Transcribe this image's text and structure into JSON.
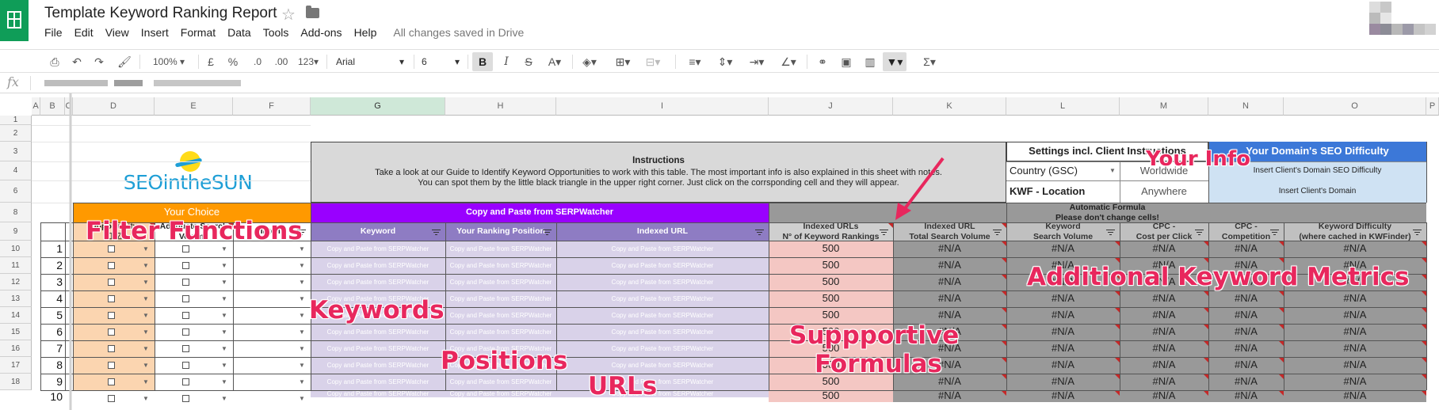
{
  "doc": {
    "title": "Template Keyword Ranking Report",
    "save_status": "All changes saved in Drive"
  },
  "menu": [
    "File",
    "Edit",
    "View",
    "Insert",
    "Format",
    "Data",
    "Tools",
    "Add-ons",
    "Help"
  ],
  "toolbar": {
    "zoom": "100%",
    "currency": "£",
    "percent": "%",
    "dec_less": ".0",
    "dec_more": ".00",
    "format_more": "123",
    "font": "Arial",
    "font_size": "6",
    "bold": "B",
    "italic": "I",
    "strike": "S",
    "text_color": "A",
    "sum": "Σ"
  },
  "formula": {
    "fx": "fx"
  },
  "columns": [
    "A",
    "B",
    "C",
    "D",
    "E",
    "F",
    "G",
    "H",
    "I",
    "J",
    "K",
    "L",
    "M",
    "N",
    "O",
    "P"
  ],
  "selected_column": "G",
  "row_numbers": [
    "1",
    "2",
    "3",
    "4",
    "6",
    "8",
    "9",
    "10",
    "11",
    "12",
    "13",
    "14",
    "15",
    "16",
    "17",
    "18"
  ],
  "logo": {
    "text": "SEOintheSUN"
  },
  "instructions": {
    "title": "Instructions",
    "line1": "Take a look at our Guide to Identify Keyword Opportunities to work with this table. The most important info is also explained in this sheet with notes.",
    "line2": "You can spot them by the little black triangle in the upper right corner. Just click on the corrsponding cell and they will appear."
  },
  "settings": {
    "title": "Settings incl. Client Instructions",
    "country_label": "Country (GSC)",
    "country_value": "Worldwide",
    "location_label": "KWF - Location",
    "location_value": "Anywhere"
  },
  "seo_difficulty": {
    "title": "Your Domain's SEO Difficulty",
    "line1": "Insert Client's Domain SEO Difficulty",
    "line2": "Insert Client's Domain"
  },
  "groups": {
    "your_choice": "Your Choice",
    "copy_paste": "Copy and Paste from SERPWatcher",
    "auto_line1": "Automatic Formula",
    "auto_line2": "Please don't change cells!"
  },
  "headers": {
    "opportunity": "Opportunity",
    "checkbox_marks": "☐,☑",
    "adequate_line1": "Adequate Search",
    "adequate_line2": "Volume",
    "intent": "Intent",
    "keyword": "Keyword",
    "ranking_position": "Your Ranking Position",
    "indexed_url": "Indexed URL",
    "indexed_urls_line1": "Indexed URLs",
    "indexed_urls_line2": "N° of Keyword Rankings",
    "total_volume_line1": "Indexed URL",
    "total_volume_line2": "Total Search Volume",
    "kw_volume_line1": "Keyword",
    "kw_volume_line2": "Search Volume",
    "cpc_line1": "CPC -",
    "cpc_line2": "Cost per Click",
    "cpc_comp_line1": "CPC -",
    "cpc_comp_line2": "Competition",
    "difficulty_line1": "Keyword Difficulty",
    "difficulty_line2": "(where cached in KWFinder)"
  },
  "row_index": [
    "1",
    "2",
    "3",
    "4",
    "5",
    "6",
    "7",
    "8",
    "9",
    "10"
  ],
  "placeholder": "Copy and Paste from SERPWatcher",
  "indexed_value": "500",
  "na": "#N/A",
  "annotations": {
    "filter": "Filter Functions",
    "keywords": "Keywords",
    "positions": "Positions",
    "urls": "URLs",
    "supportive_1": "Suppportive",
    "supportive_2": "Formulas",
    "metrics": "Additional Keyword Metrics",
    "your_info": "Your Info"
  },
  "colors": {
    "sheets_green": "#0f9d58",
    "orange": "#ff9900",
    "orange_light": "#fbd5b0",
    "purple": "#9900ff",
    "lavender": "#8e7cc3",
    "lavender_light": "#d9d2e9",
    "salmon": "#f4c7c3",
    "gray_dark": "#999999",
    "gray_header": "#c0c0c0",
    "blue": "#3c78d8",
    "blue_light": "#cfe2f3",
    "annotation_pink": "#e8275d"
  }
}
